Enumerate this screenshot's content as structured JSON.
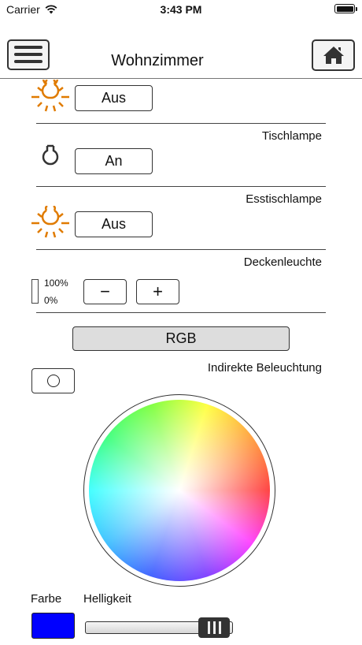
{
  "status_bar": {
    "carrier": "Carrier",
    "time": "3:43 PM"
  },
  "header": {
    "title": "Wohnzimmer"
  },
  "rows": [
    {
      "state_label": "Aus",
      "lamp_on": true
    },
    {
      "name": "Tischlampe",
      "state_label": "An",
      "lamp_on": false
    },
    {
      "name": "Esstischlampe",
      "state_label": "Aus",
      "lamp_on": true
    }
  ],
  "dimmer": {
    "name": "Deckenleuchte",
    "max_label": "100%",
    "min_label": "0%",
    "minus_label": "−",
    "plus_label": "+",
    "level": 0
  },
  "rgb": {
    "button_label": "RGB",
    "name": "Indirekte Beleuchtung"
  },
  "color": {
    "farbe_label": "Farbe",
    "helligkeit_label": "Helligkeit",
    "swatch_color": "#0000ff",
    "brightness": 0.97
  },
  "colors": {
    "lamp_accent": "#e07b00"
  }
}
